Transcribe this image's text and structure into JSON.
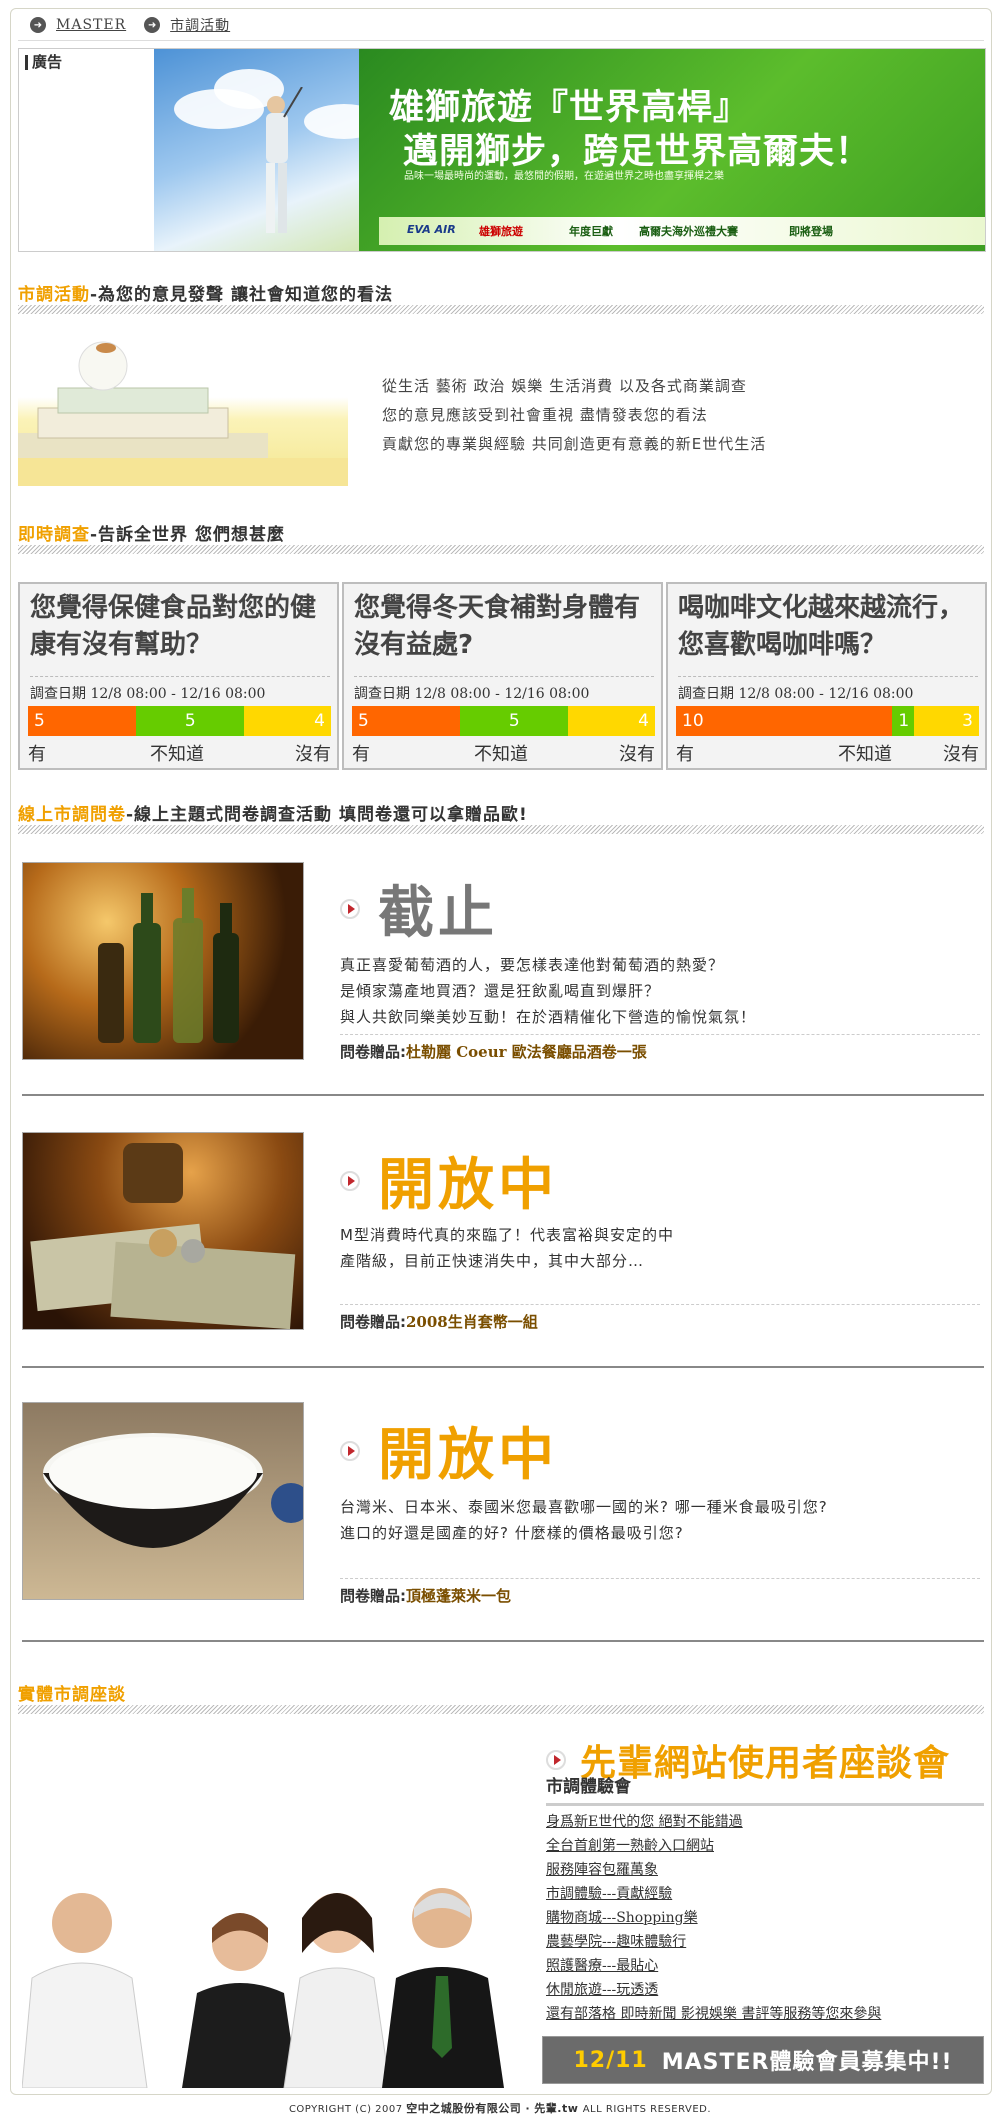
{
  "breadcrumb": {
    "home": "MASTER",
    "current": "市調活動"
  },
  "ad": {
    "label": "廣告",
    "title1": "雄獅旅遊『世界高桿』",
    "title2": "邁開獅步，跨足世界高爾夫！",
    "subtitle": "品味一場最時尚的運動，最悠閒的假期，在遊遍世界之時也盡享揮桿之樂",
    "brand": "EVA AIR",
    "sponsor": "雄獅旅遊",
    "tagline1": "年度巨獻",
    "tagline2": "高爾夫海外巡禮大賽",
    "tagline3": "即將登場"
  },
  "sections": {
    "activity_title": "市調活動",
    "activity_sub": "-為您的意見發聲  讓社會知道您的看法",
    "instant_title": "即時調查",
    "instant_sub": "-告訴全世界  您們想甚麼",
    "online_title": "線上市調問卷",
    "online_sub": "-線上主題式問卷調查活動  填問卷還可以拿贈品歐!",
    "forum_title": "實體市調座談"
  },
  "intro": [
    "從生活 藝術 政治 娛樂 生活消費 以及各式商業調查",
    "您的意見應該受到社會重視 盡情發表您的看法",
    "貢獻您的專業與經驗 共同創造更有意義的新E世代生活"
  ],
  "polls": [
    {
      "question": "您覺得保健食品對您的健康有沒有幫助？",
      "date": "調查日期 12/8 08:00 - 12/16 08:00",
      "yes": 5,
      "unsure": 5,
      "no": 4,
      "label_yes": "有",
      "label_unsure": "不知道",
      "label_no": "沒有"
    },
    {
      "question": "您覺得冬天食補對身體有沒有益處?",
      "date": "調查日期 12/8 08:00 - 12/16 08:00",
      "yes": 5,
      "unsure": 5,
      "no": 4,
      "label_yes": "有",
      "label_unsure": "不知道",
      "label_no": "沒有"
    },
    {
      "question": "喝咖啡文化越來越流行，您喜歡喝咖啡嗎？",
      "date": "調查日期 12/8 08:00 - 12/16 08:00",
      "yes": 10,
      "unsure": 1,
      "no": 3,
      "label_yes": "有",
      "label_unsure": "不知道",
      "label_no": "沒有"
    }
  ],
  "surveys": [
    {
      "status": "截止",
      "lines": [
        "真正喜愛葡萄酒的人，要怎樣表達他對葡萄酒的熱愛？",
        "是傾家蕩產地買酒？還是狂飲亂喝直到爆肝？",
        "與人共飲同樂美妙互動！在於酒精催化下營造的愉悅氣氛！"
      ],
      "gift_label": "問卷贈品:",
      "gift": "杜勒麗 Coeur 歐法餐廳品酒卷一張"
    },
    {
      "status": "開放中",
      "lines": [
        "M型消費時代真的來臨了！代表富裕與安定的中",
        "產階級，目前正快速消失中，其中大部分…"
      ],
      "gift_label": "問卷贈品:",
      "gift": "2008生肖套幣一組"
    },
    {
      "status": "開放中",
      "lines": [
        "台灣米、日本米、泰國米您最喜歡哪一國的米? 哪一種米食最吸引您?",
        "進口的好還是國產的好? 什麼樣的價格最吸引您?"
      ],
      "gift_label": "問卷贈品:",
      "gift": "頂極蓬萊米一包"
    }
  ],
  "forum": {
    "title": "先輩網站使用者座談會",
    "subtitle": "市調體驗會",
    "items": [
      "身爲新E世代的您  絕對不能錯過",
      "全台首創第一熟齡入口網站",
      "服務陣容包羅萬象",
      "市調體驗---貢獻經驗",
      "購物商城---Shopping樂",
      "農藝學院---趣味體驗行",
      "照護醫療---最貼心",
      "休閒旅遊---玩透透",
      "還有部落格 即時新聞 影視娛樂 書評等服務等您來參與"
    ],
    "recruit_date": "12/11",
    "recruit_text": "MASTER體驗會員募集中!!"
  },
  "footer": {
    "text1": "COPYRIGHT (C) 2007 ",
    "company": "空中之城股份有限公司",
    "text2": " ‧ 先輩.tw ",
    "text3": "ALL RIGHTS RESERVED."
  },
  "colors": {
    "accent": "#f0a000",
    "bar_yes": "#ff6600",
    "bar_unsure": "#66cc00",
    "bar_no": "#ffd800",
    "closed": "#777777"
  }
}
